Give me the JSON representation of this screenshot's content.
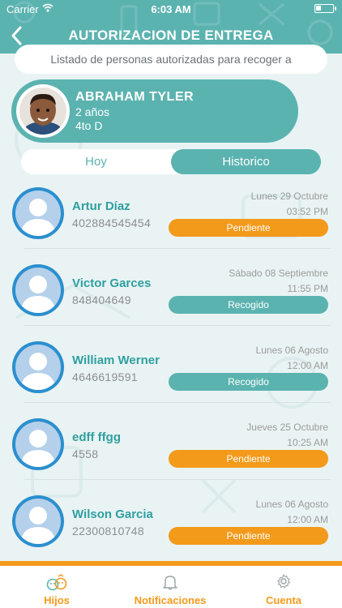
{
  "status_bar": {
    "carrier": "Carrier",
    "time": "6:03 AM"
  },
  "header": {
    "title": "AUTORIZACION DE ENTREGA"
  },
  "subtitle": "Listado de personas autorizadas para recoger a",
  "child": {
    "name": "ABRAHAM TYLER",
    "age": "2 años",
    "grade": "4to D"
  },
  "tabs": {
    "today": "Hoy",
    "history": "Historico",
    "selected": "history"
  },
  "persons": [
    {
      "name": "Artur Díaz",
      "phone": "402884545454",
      "date": "Lunes 29 Octubre",
      "time": "03:52 PM",
      "status": "Pendiente"
    },
    {
      "name": "Victor  Garces",
      "phone": "848404649",
      "date": "Sábado 08 Septiembre",
      "time": "11:55 PM",
      "status": "Recogido"
    },
    {
      "name": "William  Werner",
      "phone": "4646619591",
      "date": "Lunes 06 Agosto",
      "time": "12:00 AM",
      "status": "Recogido"
    },
    {
      "name": "edff ffgg",
      "phone": "4558",
      "date": "Jueves 25 Octubre",
      "time": "10:25 AM",
      "status": "Pendiente"
    },
    {
      "name": "Wilson Garcia",
      "phone": "22300810748",
      "date": "Lunes 06 Agosto",
      "time": "12:00 AM",
      "status": "Pendiente"
    }
  ],
  "status_colors": {
    "Pendiente": "#f39a1b",
    "Recogido": "#5bb3b0"
  },
  "tabbar": {
    "hijos": "Hijos",
    "notificaciones": "Notificaciones",
    "cuenta": "Cuenta"
  },
  "icons": {
    "back": "chevron-left-icon",
    "hijos": "kids-faces-icon",
    "notificaciones": "bell-icon",
    "cuenta": "gear-icon",
    "avatar": "user-silhouette-icon"
  }
}
